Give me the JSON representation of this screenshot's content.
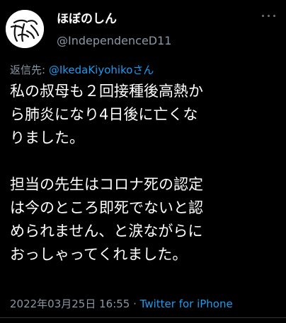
{
  "tweet": {
    "display_name": "ほぼのしん",
    "handle": "@IndependenceD11",
    "reply_prefix": "返信先: ",
    "reply_mention": "@IkedaKiyohikoさん",
    "body_lines_1": [
      "私の叔母も２回接種後高熱か",
      "ら肺炎になり4日後に亡くな",
      "りました。"
    ],
    "body_lines_2": [
      "担当の先生はコロナ死の認定",
      "は今のところ即死でないと認",
      "められません、と涙ながらに",
      "おっしゃってくれました。"
    ],
    "timestamp": "2022年03月25日 16:55",
    "separator": " · ",
    "client": "Twitter for iPhone"
  },
  "icons": {
    "avatar": "avatar-image",
    "more": "more-options-icon"
  },
  "colors": {
    "background": "#000000",
    "text_primary": "#ffffff",
    "text_secondary": "#8b98a5",
    "accent": "#1d9bf0"
  }
}
